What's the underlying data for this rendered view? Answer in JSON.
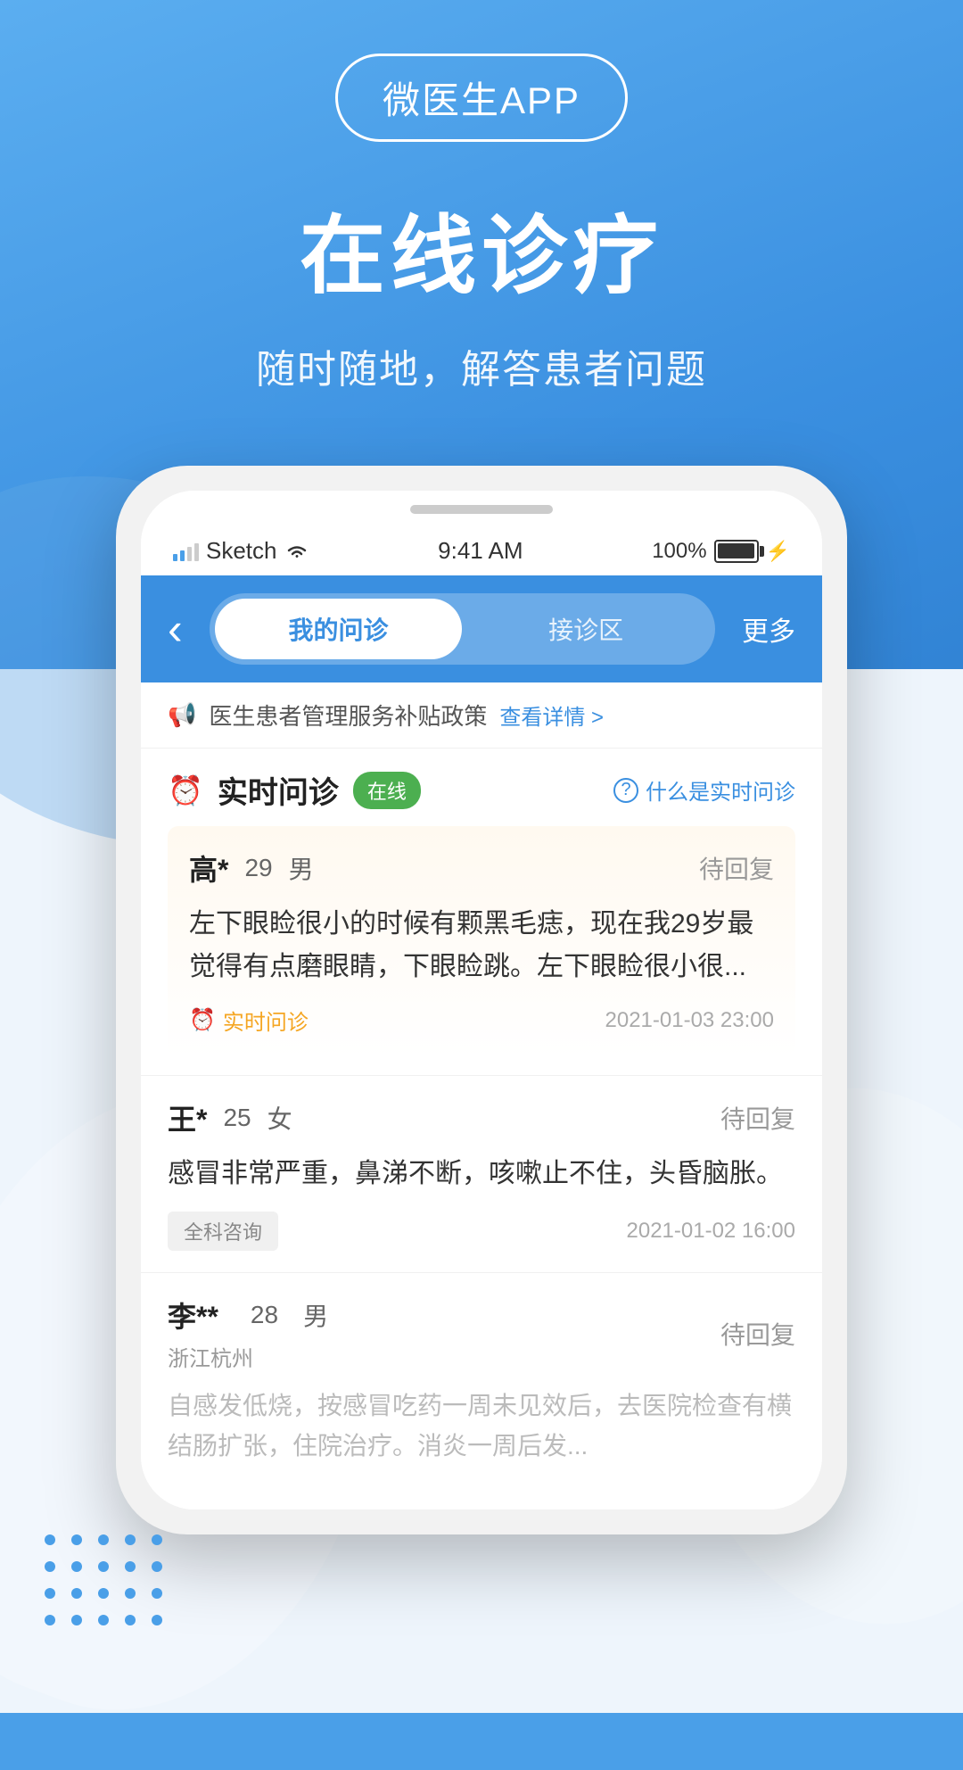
{
  "app": {
    "badge_text": "微医生APP",
    "hero_title": "在线诊疗",
    "hero_subtitle": "随时随地，解答患者问题"
  },
  "status_bar": {
    "carrier": "Sketch",
    "time": "9:41 AM",
    "battery": "100%"
  },
  "nav": {
    "back_label": "‹",
    "tab1_label": "我的问诊",
    "tab2_label": "接诊区",
    "more_label": "更多"
  },
  "notice": {
    "icon": "📢",
    "text": "医生患者管理服务补贴政策",
    "link_text": "查看详情 >"
  },
  "consult_section": {
    "clock_icon": "⏰",
    "title": "实时问诊",
    "online_badge": "在线",
    "help_icon": "？",
    "help_text": "什么是实时问诊"
  },
  "patients": [
    {
      "name": "高*",
      "age": "29",
      "gender": "男",
      "location": "",
      "status": "待回复",
      "content": "左下眼睑很小的时候有颗黑毛痣，现在我29岁最觉得有点磨眼睛，下眼睑跳。左下眼睑很小很...",
      "type_label": "实时问诊",
      "type_icon": "⏰",
      "type_color": "#F5A623",
      "time": "2021-01-03 23:00",
      "bg": "warm"
    },
    {
      "name": "王*",
      "age": "25",
      "gender": "女",
      "location": "",
      "status": "待回复",
      "content": "感冒非常严重，鼻涕不断，咳嗽止不住，头昏脑胀。",
      "type_label": "全科咨询",
      "type_icon": "",
      "type_color": "",
      "time": "2021-01-02 16:00",
      "bg": "white"
    },
    {
      "name": "李**",
      "age": "28",
      "gender": "男",
      "location": "浙江杭州",
      "status": "待回复",
      "content": "自感发低烧，按感冒吃药一周未见效后，去医院检查有横结肠扩张，住院治疗。消炎一周后发...",
      "type_label": "",
      "type_icon": "",
      "type_color": "",
      "time": "",
      "bg": "white"
    }
  ]
}
